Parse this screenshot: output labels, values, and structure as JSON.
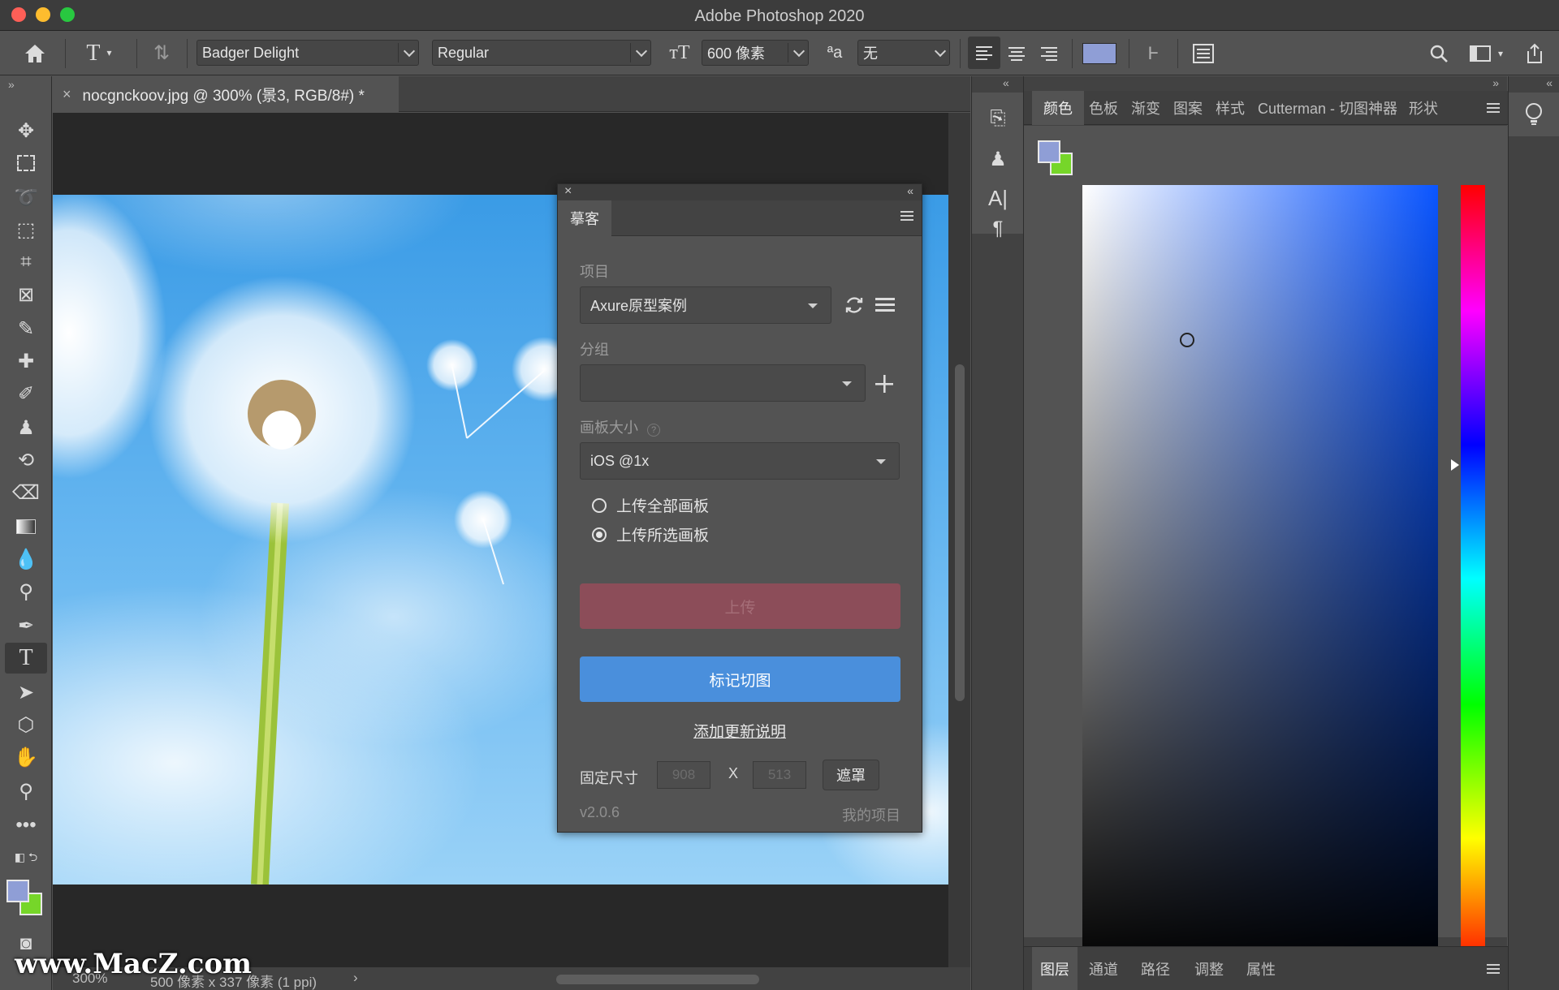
{
  "window": {
    "title": "Adobe Photoshop 2020"
  },
  "options_bar": {
    "font_family": "Badger Delight",
    "font_style": "Regular",
    "font_size": "600 像素",
    "antialias": "无",
    "text_color": "#8f9ed6"
  },
  "document": {
    "tab_title": "nocgnckoov.jpg @ 300% (景3, RGB/8#) *",
    "zoom": "300%",
    "size_info": "500 像素 x 337 像素 (1 ppi)"
  },
  "panel": {
    "tab": "摹客",
    "project_label": "项目",
    "project_value": "Axure原型案例",
    "group_label": "分组",
    "group_value": "",
    "board_size_label": "画板大小",
    "board_size_value": "iOS @1x",
    "radio_all": "上传全部画板",
    "radio_selected": "上传所选画板",
    "upload_button": "上传",
    "mark_button": "标记切图",
    "add_note_link": "添加更新说明",
    "fixed_size_label": "固定尺寸",
    "width_placeholder": "908",
    "times": "X",
    "height_placeholder": "513",
    "mask_button": "遮罩",
    "version": "v2.0.6",
    "my_projects": "我的项目"
  },
  "right_panel": {
    "tabs": [
      "颜色",
      "色板",
      "渐变",
      "图案",
      "样式",
      "Cutterman - 切图神器",
      "形状"
    ],
    "bottom_tabs": [
      "图层",
      "通道",
      "路径",
      "调整",
      "属性"
    ],
    "foreground_color": "#8f9ed6",
    "background_color": "#76d629"
  },
  "watermark": "www.MacZ.com"
}
